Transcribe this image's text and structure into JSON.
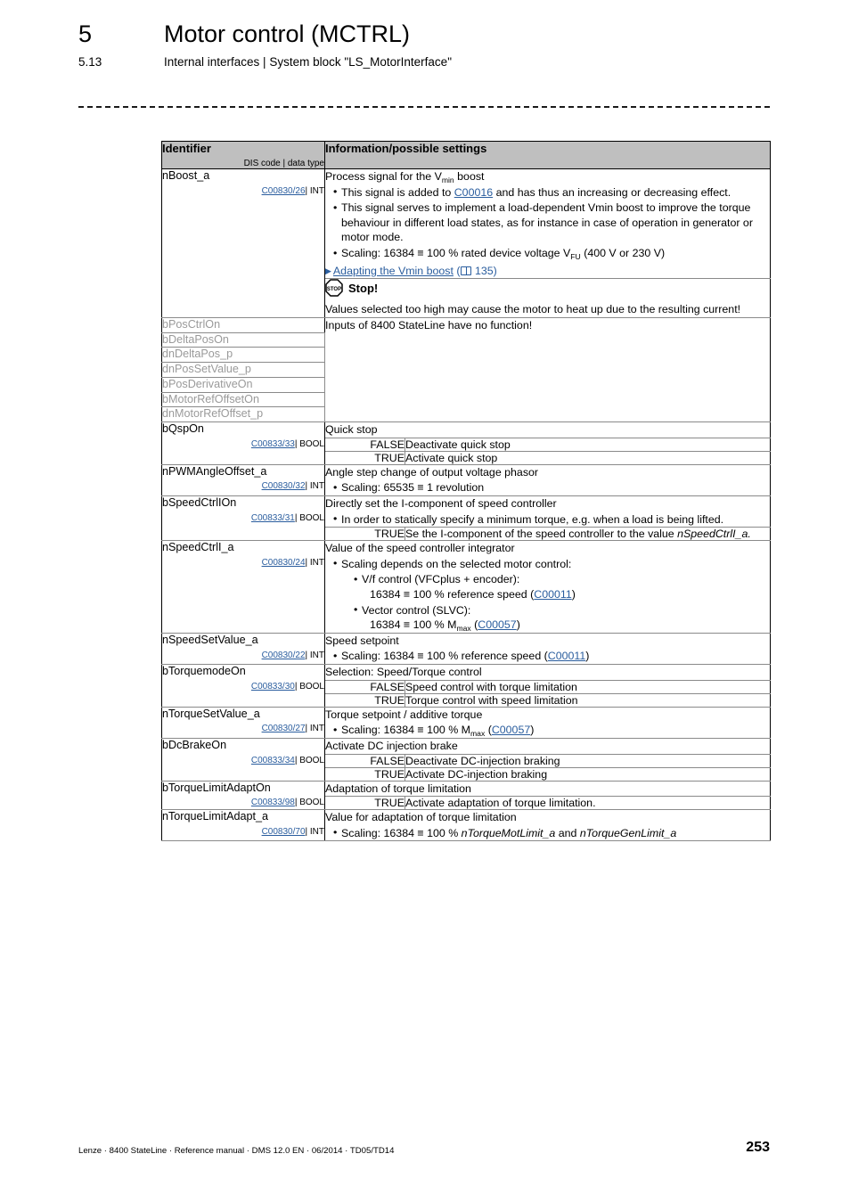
{
  "header": {
    "chapter_number": "5",
    "chapter_title": "Motor control (MCTRL)",
    "section_number": "5.13",
    "section_title": "Internal interfaces | System block \"LS_MotorInterface\""
  },
  "table": {
    "col_identifier": "Identifier",
    "col_identifier_sub": "DIS code | data type",
    "col_information": "Information/possible settings"
  },
  "rows": {
    "nboost": {
      "id": "nBoost_a",
      "code": "C00830/26",
      "dtype": "| INT",
      "intro_a": "Process signal for the V",
      "intro_sub": "min",
      "intro_b": " boost",
      "b1_a": "This signal is added to ",
      "b1_link": "C00016",
      "b1_b": " and has thus an increasing or decreasing effect.",
      "b2": "This signal serves to implement a load-dependent Vmin boost to improve the torque behaviour in different load states, as for instance in case of operation in generator or motor mode.",
      "b3_a": "Scaling: 16384 ≡ 100 % rated device voltage V",
      "b3_sub": "FU",
      "b3_b": " (400 V or 230 V)",
      "xlink_text": "Adapting the Vmin boost",
      "xlink_page": "135"
    },
    "stop": {
      "icon_label": "STOP",
      "title": "Stop!",
      "body": "Values selected too high may cause the motor to heat up due to the resulting current!"
    },
    "nofunction": {
      "note": "Inputs of 8400 StateLine have no function!",
      "ids": [
        "bPosCtrlOn",
        "bDeltaPosOn",
        "dnDeltaPos_p",
        "dnPosSetValue_p",
        "bPosDerivativeOn",
        "bMotorRefOffsetOn",
        "dnMotorRefOffset_p"
      ]
    },
    "bqspon": {
      "id": "bQspOn",
      "code": "C00833/33",
      "dtype": "| BOOL",
      "title": "Quick stop",
      "false_label": "FALSE",
      "false_desc": "Deactivate quick stop",
      "true_label": "TRUE",
      "true_desc": "Activate quick stop"
    },
    "npwm": {
      "id": "nPWMAngleOffset_a",
      "code": "C00830/32",
      "dtype": "| INT",
      "title": "Angle step change of output voltage phasor",
      "b1": "Scaling: 65535 ≡ 1 revolution"
    },
    "bspeedctrl": {
      "id": "bSpeedCtrlIOn",
      "code": "C00833/31",
      "dtype": "| BOOL",
      "title": "Directly set the I-component of speed controller",
      "b1": "In order to statically specify a minimum torque, e.g. when a load is being lifted.",
      "true_label": "TRUE",
      "true_desc_a": "Se the I-component of the speed controller to the value ",
      "true_desc_ital": "nSpeedCtrlI_a."
    },
    "nspeedctrl": {
      "id": "nSpeedCtrlI_a",
      "code": "C00830/24",
      "dtype": "| INT",
      "title": "Value of the speed controller integrator",
      "b1": "Scaling depends on the selected motor control:",
      "s1_line1": "V/f control (VFCplus + encoder):",
      "s1_line2_a": "16384 ≡ 100 % reference speed (",
      "s1_line2_link": "C00011",
      "s1_line2_b": ")",
      "s2_line1": "Vector control (SLVC):",
      "s2_line2_a": "16384 ≡ 100 % M",
      "s2_line2_sub": "max",
      "s2_line2_mid": " (",
      "s2_line2_link": "C00057",
      "s2_line2_b": ")"
    },
    "nspeedset": {
      "id": "nSpeedSetValue_a",
      "code": "C00830/22",
      "dtype": "| INT",
      "title": "Speed setpoint",
      "b1_a": "Scaling: 16384 ≡ 100 % reference speed (",
      "b1_link": "C00011",
      "b1_b": ")"
    },
    "btorquemode": {
      "id": "bTorquemodeOn",
      "code": "C00833/30",
      "dtype": "| BOOL",
      "title": "Selection: Speed/Torque control",
      "false_label": "FALSE",
      "false_desc": "Speed control with torque limitation",
      "true_label": "TRUE",
      "true_desc": "Torque control with speed limitation"
    },
    "ntorqueset": {
      "id": "nTorqueSetValue_a",
      "code": "C00830/27",
      "dtype": "| INT",
      "title": "Torque setpoint / additive torque",
      "b1_a": "Scaling: 16384 ≡ 100 % M",
      "b1_sub": "max",
      "b1_mid": " (",
      "b1_link": "C00057",
      "b1_b": ")"
    },
    "bdcbrake": {
      "id": "bDcBrakeOn",
      "code": "C00833/34",
      "dtype": "| BOOL",
      "title": "Activate DC injection brake",
      "false_label": "FALSE",
      "false_desc": "Deactivate DC-injection braking",
      "true_label": "TRUE",
      "true_desc": "Activate DC-injection braking"
    },
    "btorquelimit": {
      "id": "bTorqueLimitAdaptOn",
      "code": "C00833/98",
      "dtype": "| BOOL",
      "title": "Adaptation of torque limitation",
      "true_label": "TRUE",
      "true_desc": "Activate adaptation of torque limitation."
    },
    "ntorquelimit": {
      "id": "nTorqueLimitAdapt_a",
      "code": "C00830/70",
      "dtype": "| INT",
      "title": "Value for adaptation of torque limitation",
      "b1_a": "Scaling: 16384 ≡ 100 % ",
      "b1_ital1": "nTorqueMotLimit_a",
      "b1_mid": " and ",
      "b1_ital2": "nTorqueGenLimit_a"
    }
  },
  "footer": {
    "text": "Lenze · 8400 StateLine · Reference manual · DMS 12.0 EN · 06/2014 · TD05/TD14",
    "page": "253"
  },
  "colors": {
    "link": "#2a5d9e",
    "header_bg": "#bfbfbf",
    "dim_text": "#9a9a9a"
  }
}
